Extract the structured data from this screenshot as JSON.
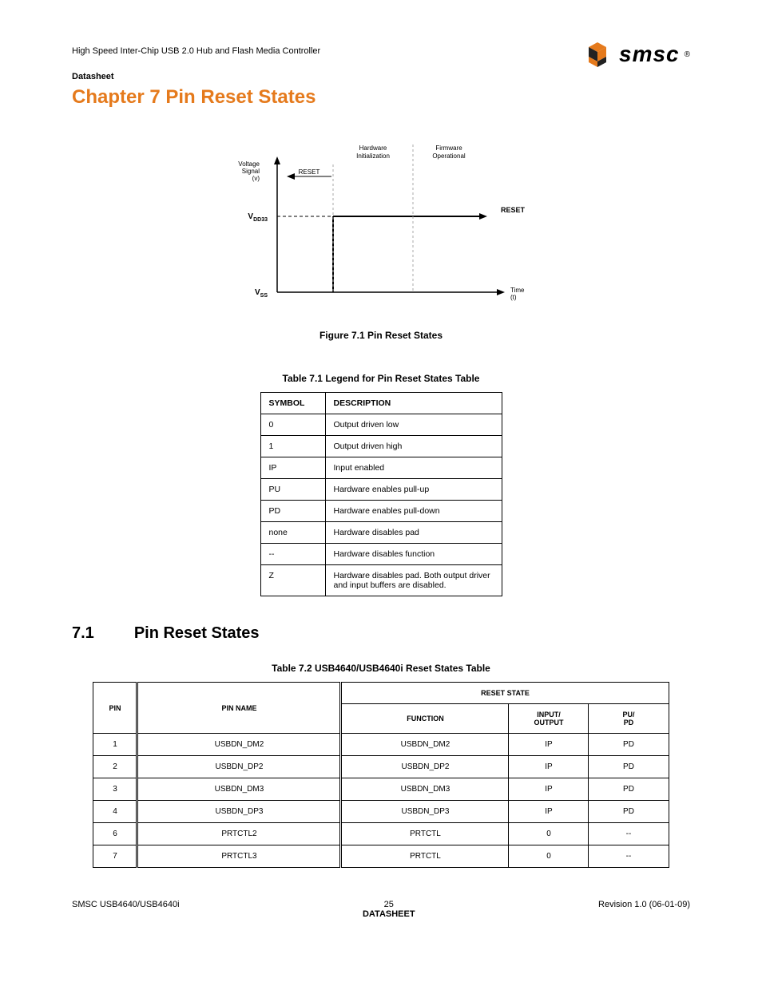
{
  "header": {
    "doc_title": "High Speed Inter-Chip USB 2.0 Hub and Flash Media Controller",
    "datasheet_label": "Datasheet",
    "chapter_title": "Chapter 7 Pin Reset States",
    "logo_text": "smsc",
    "logo_reg": "®"
  },
  "figure": {
    "caption": "Figure 7.1 Pin Reset States",
    "y_label_top": "Voltage",
    "y_label_mid": "Signal",
    "y_label_bot": "(v)",
    "vdd": "V",
    "vdd_sub": "DD33",
    "vss": "V",
    "vss_sub": "SS",
    "reset_left": "RESET",
    "hw_init": "Hardware",
    "hw_init2": "Initialization",
    "fw_op": "Firmware",
    "fw_op2": "Operational",
    "reset_right": "RESET",
    "time": "Time",
    "time_sub": "(t)"
  },
  "legend": {
    "caption": "Table 7.1  Legend for Pin Reset States Table",
    "col_symbol": "Symbol",
    "col_desc": "Description",
    "rows": [
      {
        "sym": "0",
        "desc": "Output driven low"
      },
      {
        "sym": "1",
        "desc": "Output driven high"
      },
      {
        "sym": "IP",
        "desc": "Input enabled"
      },
      {
        "sym": "PU",
        "desc": "Hardware enables pull-up"
      },
      {
        "sym": "PD",
        "desc": "Hardware enables pull-down"
      },
      {
        "sym": "none",
        "desc": "Hardware disables pad"
      },
      {
        "sym": "--",
        "desc": "Hardware disables function"
      },
      {
        "sym": "Z",
        "desc": "Hardware disables pad. Both output driver and input buffers are disabled."
      }
    ]
  },
  "section": {
    "num": "7.1",
    "title": "Pin Reset States"
  },
  "reset_table": {
    "caption": "Table 7.2  USB4640/USB4640i Reset States Table",
    "head_reset_state": "RESET STATE",
    "head_pin": "PIN",
    "head_pin_name": "PIN NAME",
    "head_function": "FUNCTION",
    "head_io": "INPUT/\nOUTPUT",
    "head_pupd": "PU/\nPD",
    "rows": [
      {
        "pin": "1",
        "name": "USBDN_DM2",
        "func": "USBDN_DM2",
        "io": "IP",
        "pupd": "PD"
      },
      {
        "pin": "2",
        "name": "USBDN_DP2",
        "func": "USBDN_DP2",
        "io": "IP",
        "pupd": "PD"
      },
      {
        "pin": "3",
        "name": "USBDN_DM3",
        "func": "USBDN_DM3",
        "io": "IP",
        "pupd": "PD"
      },
      {
        "pin": "4",
        "name": "USBDN_DP3",
        "func": "USBDN_DP3",
        "io": "IP",
        "pupd": "PD"
      },
      {
        "pin": "6",
        "name": "PRTCTL2",
        "func": "PRTCTL",
        "io": "0",
        "pupd": "--"
      },
      {
        "pin": "7",
        "name": "PRTCTL3",
        "func": "PRTCTL",
        "io": "0",
        "pupd": "--"
      }
    ]
  },
  "footer": {
    "left": "SMSC USB4640/USB4640i",
    "page": "25",
    "ds": "DATASHEET",
    "right": "Revision 1.0 (06-01-09)"
  }
}
